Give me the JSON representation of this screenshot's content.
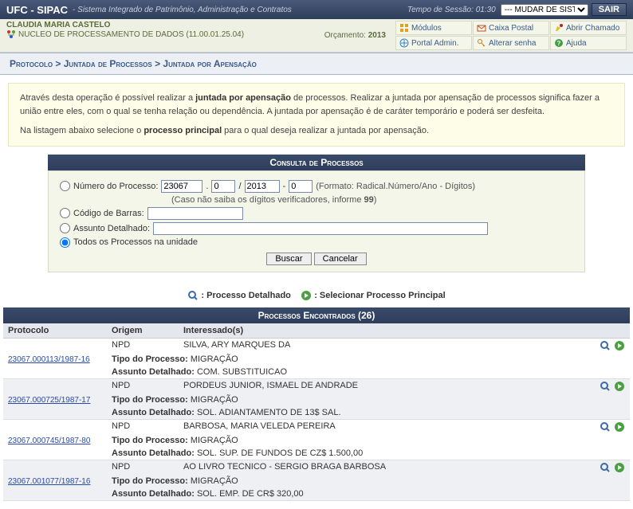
{
  "top": {
    "sys": "UFC - SIPAC",
    "desc": "- Sistema Integrado de Patrimônio, Administração e Contratos",
    "sessLabel": "Tempo de Sessão:",
    "sessVal": "01:30",
    "switch": "--- MUDAR DE SISTE",
    "exit": "SAIR"
  },
  "user": {
    "name": "CLAUDIA MARIA CASTELO",
    "unit": "NUCLEO DE PROCESSAMENTO DE DADOS (11.00.01.25.04)",
    "orcLabel": "Orçamento:",
    "orcYear": "2013"
  },
  "links": {
    "l0": "Módulos",
    "l1": "Caixa Postal",
    "l2": "Abrir Chamado",
    "l3": "Portal Admin.",
    "l4": "Alterar senha",
    "l5": "Ajuda"
  },
  "breadcrumb": "Protocolo > Juntada de Processos > Juntada por Apensação",
  "info": {
    "p1a": "Através desta operação é possível realizar a ",
    "p1b": "juntada por apensação",
    "p1c": " de processos. Realizar a juntada por apensação de processos significa fazer a união entre eles, com o qual se tenha relação ou dependência. A juntada por apensação é de caráter temporário e poderá ser desfeita.",
    "p2a": "Na listagem abaixo selecione o ",
    "p2b": "processo principal",
    "p2c": " para o qual deseja realizar a juntada por apensação."
  },
  "panel": {
    "title": "Consulta de Processos",
    "optNum": "Número do Processo:",
    "v1": "23067",
    "v2": "0",
    "v3": "2013",
    "v4": "0",
    "fmt": "(Formato: Radical.Número/Ano - Dígitos)",
    "hint": "(Caso não saiba os dígitos verificadores, informe ",
    "hintB": "99",
    "hintC": ")",
    "optBar": "Código de Barras:",
    "optAss": "Assunto Detalhado:",
    "optAll": "Todos os Processos na unidade",
    "btnSearch": "Buscar",
    "btnCancel": "Cancelar"
  },
  "legend": {
    "a": ": Processo Detalhado",
    "b": ": Selecionar Processo Principal"
  },
  "grid": {
    "title": "Processos Encontrados (26)",
    "hProt": "Protocolo",
    "hOrig": "Origem",
    "hInt": "Interessado(s)",
    "lblTipo": "Tipo do Processo:",
    "lblAss": "Assunto Detalhado:",
    "rows": [
      {
        "prot": "23067.000113/1987-16",
        "orig": "NPD",
        "int": "SILVA, ARY MARQUES DA",
        "tipo": "MIGRAÇÃO",
        "ass": "COM. SUBSTITUICAO"
      },
      {
        "prot": "23067.000725/1987-17",
        "orig": "NPD",
        "int": "PORDEUS JUNIOR, ISMAEL DE ANDRADE",
        "tipo": "MIGRAÇÃO",
        "ass": "SOL. ADIANTAMENTO DE 13$ SAL."
      },
      {
        "prot": "23067.000745/1987-80",
        "orig": "NPD",
        "int": "BARBOSA, MARIA VELEDA PEREIRA",
        "tipo": "MIGRAÇÃO",
        "ass": "SOL. SUP. DE FUNDOS DE CZ$ 1.500,00"
      },
      {
        "prot": "23067.001077/1987-16",
        "orig": "NPD",
        "int": "AO LIVRO TECNICO - SERGIO BRAGA BARBOSA",
        "tipo": "MIGRAÇÃO",
        "ass": "SOL. EMP. DE CR$ 320,00"
      }
    ]
  }
}
